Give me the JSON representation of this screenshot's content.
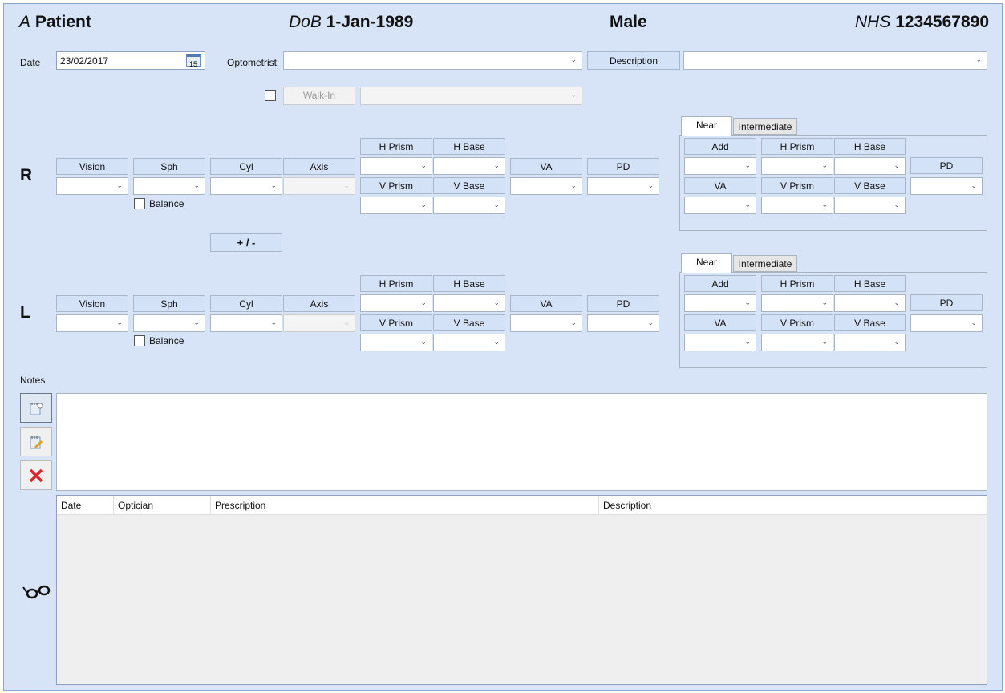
{
  "header": {
    "first_name": "A",
    "last_name": "Patient",
    "dob_label": "DoB",
    "dob": "1-Jan-1989",
    "sex": "Male",
    "nhs_label": "NHS",
    "nhs_number": "1234567890"
  },
  "form": {
    "date_label": "Date",
    "date_value": "23/02/2017",
    "calendar_day": "15",
    "optometrist_label": "Optometrist",
    "optometrist_value": "",
    "description_label": "Description",
    "description_value": "",
    "walkin_checked": false,
    "walkin_label": "Walk-In",
    "walkin_value": ""
  },
  "rx_labels": {
    "vision": "Vision",
    "sph": "Sph",
    "cyl": "Cyl",
    "axis": "Axis",
    "h_prism": "H Prism",
    "h_base": "H Base",
    "v_prism": "V Prism",
    "v_base": "V Base",
    "va": "VA",
    "pd": "PD",
    "balance": "Balance",
    "add": "Add"
  },
  "eyes": [
    {
      "label": "R",
      "balance_checked": false,
      "active_tab": "Near"
    },
    {
      "label": "L",
      "balance_checked": false,
      "active_tab": "Near"
    }
  ],
  "tabs": [
    "Near",
    "Intermediate"
  ],
  "plus_minus_label": "+ / -",
  "notes": {
    "label": "Notes",
    "value": ""
  },
  "history_grid": {
    "columns": [
      "Date",
      "Optician",
      "Prescription",
      "Description"
    ],
    "rows": []
  },
  "colors": {
    "background": "#d7e4f7",
    "label_box": "#d4e2f7",
    "delete": "#d9262b"
  }
}
